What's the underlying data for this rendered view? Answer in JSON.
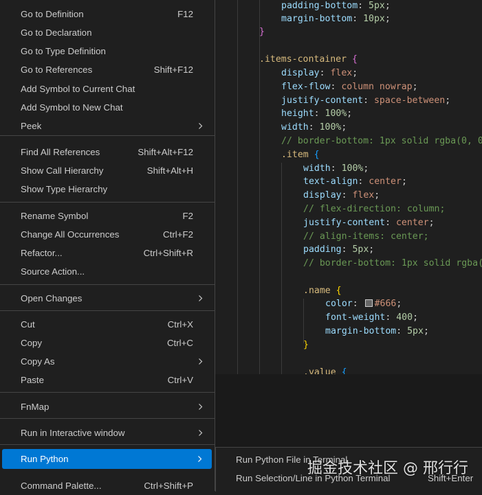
{
  "context_menu": {
    "items": [
      {
        "label": "Go to Definition",
        "shortcut": "F12"
      },
      {
        "label": "Go to Declaration",
        "shortcut": ""
      },
      {
        "label": "Go to Type Definition",
        "shortcut": ""
      },
      {
        "label": "Go to References",
        "shortcut": "Shift+F12"
      },
      {
        "label": "Add Symbol to Current Chat",
        "shortcut": ""
      },
      {
        "label": "Add Symbol to New Chat",
        "shortcut": ""
      },
      {
        "label": "Peek",
        "shortcut": "",
        "submenu": true
      },
      {
        "label": "Find All References",
        "shortcut": "Shift+Alt+F12"
      },
      {
        "label": "Show Call Hierarchy",
        "shortcut": "Shift+Alt+H"
      },
      {
        "label": "Show Type Hierarchy",
        "shortcut": ""
      },
      {
        "label": "Rename Symbol",
        "shortcut": "F2"
      },
      {
        "label": "Change All Occurrences",
        "shortcut": "Ctrl+F2"
      },
      {
        "label": "Refactor...",
        "shortcut": "Ctrl+Shift+R"
      },
      {
        "label": "Source Action...",
        "shortcut": ""
      },
      {
        "label": "Open Changes",
        "shortcut": "",
        "submenu": true
      },
      {
        "label": "Cut",
        "shortcut": "Ctrl+X"
      },
      {
        "label": "Copy",
        "shortcut": "Ctrl+C"
      },
      {
        "label": "Copy As",
        "shortcut": "",
        "submenu": true
      },
      {
        "label": "Paste",
        "shortcut": "Ctrl+V"
      },
      {
        "label": "FnMap",
        "shortcut": "",
        "submenu": true
      },
      {
        "label": "Run in Interactive window",
        "shortcut": "",
        "submenu": true
      },
      {
        "label": "Run Python",
        "shortcut": "",
        "submenu": true,
        "active": true
      },
      {
        "label": "Command Palette...",
        "shortcut": "Ctrl+Shift+P"
      }
    ]
  },
  "submenu": {
    "items": [
      {
        "label": "Run Python File in Terminal",
        "shortcut": ""
      },
      {
        "label": "Run Selection/Line in Python Terminal",
        "shortcut": "Shift+Enter"
      }
    ]
  },
  "editor": {
    "lines": [
      "padding-bottom: 5px;",
      "margin-bottom: 10px;",
      "}",
      ".items-container {",
      "display: flex;",
      "flex-flow: column nowrap;",
      "justify-content: space-between;",
      "height: 100%;",
      "width: 100%;",
      "// border-bottom: 1px solid rgba(0, 0",
      ".item {",
      "width: 100%;",
      "text-align: center;",
      "display: flex;",
      "// flex-direction: column;",
      "justify-content: center;",
      "// align-items: center;",
      "padding: 5px;",
      "// border-bottom: 1px solid rgba(",
      ".name {",
      "color: #666;",
      "font-weight: 400;",
      "margin-bottom: 5px;",
      "}",
      ".value {"
    ]
  },
  "watermark": {
    "text": "掘金技术社区 @ 邢行行"
  },
  "colors": {
    "accent": "#0078d4",
    "menu_bg": "#1f1f1f",
    "separator": "#454545",
    "swatch": "#666666"
  },
  "icons": {
    "submenu_arrow": "chevron-right-icon"
  }
}
